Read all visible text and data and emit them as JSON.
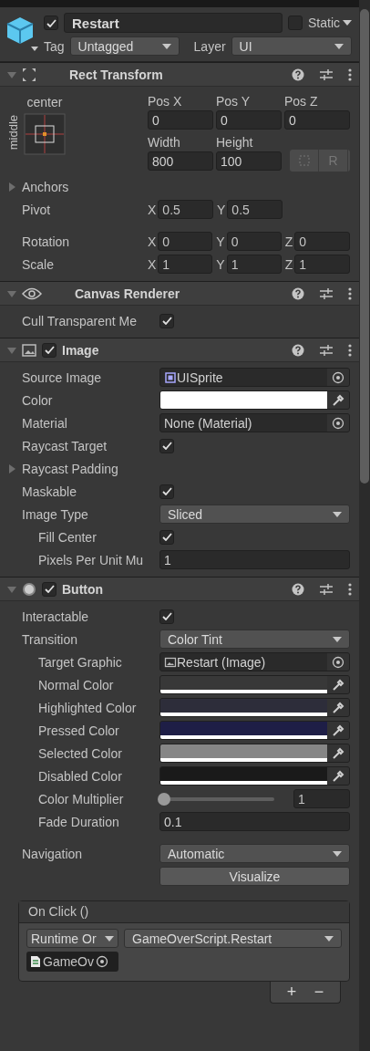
{
  "header": {
    "active": true,
    "name": "Restart",
    "static": false,
    "static_label": "Static",
    "tag_label": "Tag",
    "tag": "Untagged",
    "layer_label": "Layer",
    "layer": "UI"
  },
  "rect_transform": {
    "title": "Rect Transform",
    "expanded": true,
    "anchor_h": "center",
    "anchor_v": "middle",
    "fields": [
      {
        "label": "Pos X",
        "value": "0"
      },
      {
        "label": "Pos Y",
        "value": "0"
      },
      {
        "label": "Pos Z",
        "value": "0"
      },
      {
        "label": "Width",
        "value": "800"
      },
      {
        "label": "Height",
        "value": "100"
      }
    ],
    "raw_label": "R",
    "anchors": {
      "label": "Anchors",
      "expanded": false
    },
    "vectors": [
      {
        "label": "Pivot",
        "axes": [
          {
            "axis": "X",
            "value": "0.5"
          },
          {
            "axis": "Y",
            "value": "0.5"
          }
        ]
      },
      {
        "label": "Rotation",
        "axes": [
          {
            "axis": "X",
            "value": "0"
          },
          {
            "axis": "Y",
            "value": "0"
          },
          {
            "axis": "Z",
            "value": "0"
          }
        ]
      },
      {
        "label": "Scale",
        "axes": [
          {
            "axis": "X",
            "value": "1"
          },
          {
            "axis": "Y",
            "value": "1"
          },
          {
            "axis": "Z",
            "value": "1"
          }
        ]
      }
    ]
  },
  "components": [
    {
      "title": "Canvas Renderer",
      "kind": "renderer",
      "expanded": true,
      "rows": [
        {
          "kind": "checkbox",
          "label": "Cull Transparent Me",
          "checked": true
        }
      ]
    },
    {
      "title": "Image",
      "kind": "image",
      "enabled": true,
      "expanded": true,
      "rows": [
        {
          "kind": "sprite_object",
          "label": "Source Image",
          "value": "UISprite"
        },
        {
          "kind": "color",
          "label": "Color",
          "color": "#ffffff"
        },
        {
          "kind": "object",
          "label": "Material",
          "value": "None (Material)"
        },
        {
          "kind": "checkbox",
          "label": "Raycast Target",
          "checked": true
        },
        {
          "kind": "foldout",
          "label": "Raycast Padding",
          "expanded": false
        },
        {
          "kind": "checkbox",
          "label": "Maskable",
          "checked": true
        },
        {
          "kind": "dropdown",
          "label": "Image Type",
          "value": "Sliced",
          "children": [
            {
              "kind": "checkbox",
              "label": "Fill Center",
              "checked": true
            },
            {
              "kind": "number",
              "label": "Pixels Per Unit Mu",
              "value": "1"
            }
          ]
        }
      ]
    },
    {
      "title": "Button",
      "kind": "button",
      "enabled": true,
      "expanded": true,
      "rows": [
        {
          "kind": "checkbox",
          "label": "Interactable",
          "checked": true
        },
        {
          "kind": "dropdown",
          "label": "Transition",
          "value": "Color Tint",
          "children": [
            {
              "kind": "image_object",
              "label": "Target Graphic",
              "value": "Restart (Image)"
            },
            {
              "kind": "color",
              "label": "Normal Color",
              "color": "#383838"
            },
            {
              "kind": "color",
              "label": "Highlighted Color",
              "color": "#2d2d3a"
            },
            {
              "kind": "color",
              "label": "Pressed Color",
              "color": "#1e1e46"
            },
            {
              "kind": "color",
              "label": "Selected Color",
              "color": "#868686"
            },
            {
              "kind": "color",
              "label": "Disabled Color",
              "color": "#1a1a1a"
            },
            {
              "kind": "slider",
              "label": "Color Multiplier",
              "level": 0,
              "value": "1"
            },
            {
              "kind": "number",
              "label": "Fade Duration",
              "value": "0.1"
            }
          ]
        },
        {
          "kind": "dropdown",
          "label": "Navigation",
          "value": "Automatic"
        },
        {
          "kind": "button",
          "value": "Visualize"
        }
      ],
      "event": {
        "title": "On Click ()",
        "entries": [
          {
            "runtime": "Runtime Or",
            "function": "GameOverScript.Restart",
            "object": "GameOv"
          }
        ],
        "add": "+",
        "remove": "−"
      }
    }
  ]
}
